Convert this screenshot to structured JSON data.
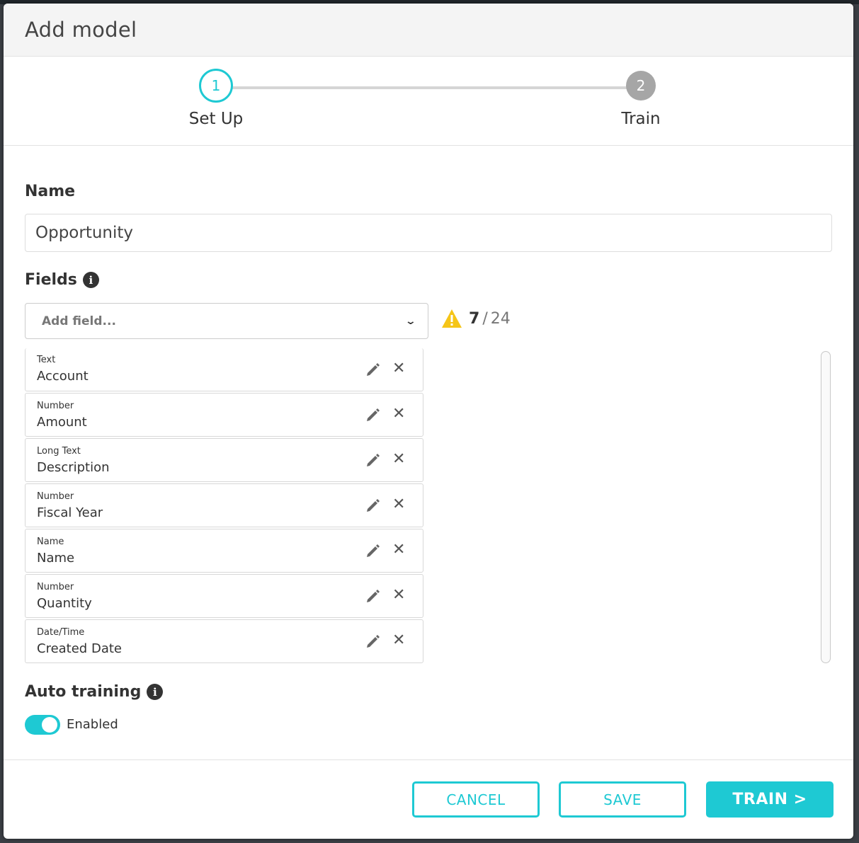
{
  "modal": {
    "title": "Add model"
  },
  "stepper": {
    "steps": [
      {
        "number": "1",
        "label": "Set Up",
        "state": "active"
      },
      {
        "number": "2",
        "label": "Train",
        "state": "inactive"
      }
    ]
  },
  "name_section": {
    "label": "Name",
    "value": "Opportunity"
  },
  "fields_section": {
    "label": "Fields",
    "add_placeholder": "Add field...",
    "count_current": "7",
    "count_separator": "/",
    "count_max": "24",
    "items": [
      {
        "type": "Text",
        "name": "Account"
      },
      {
        "type": "Number",
        "name": "Amount"
      },
      {
        "type": "Long Text",
        "name": "Description"
      },
      {
        "type": "Number",
        "name": "Fiscal Year"
      },
      {
        "type": "Name",
        "name": "Name"
      },
      {
        "type": "Number",
        "name": "Quantity"
      },
      {
        "type": "Date/Time",
        "name": "Created Date"
      }
    ]
  },
  "auto_training": {
    "label": "Auto training",
    "status": "Enabled",
    "enabled": true
  },
  "footer": {
    "cancel": "CANCEL",
    "save": "SAVE",
    "train": "TRAIN >"
  },
  "colors": {
    "accent": "#1ec9d3",
    "warning": "#f5c518",
    "inactive_step": "#a6a6a6"
  }
}
